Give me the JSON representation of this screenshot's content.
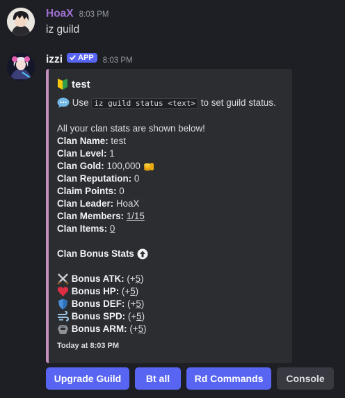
{
  "messages": [
    {
      "username": "HoaX",
      "timestamp": "8:03 PM",
      "text": "iz guild"
    },
    {
      "username": "izzi",
      "badge": "APP",
      "timestamp": "8:03 PM"
    }
  ],
  "embed": {
    "accent_color": "#c38fbe",
    "title": "test",
    "title_icon": "beginner-badge-icon",
    "hint": {
      "icon": "speech-balloon-icon",
      "prefix": "Use",
      "code": "iz guild status <text>",
      "suffix": "to set guild status."
    },
    "intro": "All your clan stats are shown below!",
    "stats": [
      {
        "label": "Clan Name:",
        "value": "test"
      },
      {
        "label": "Clan Level:",
        "value": "1"
      },
      {
        "label": "Clan Gold:",
        "value": "100,000",
        "icon": "gold-coins-icon"
      },
      {
        "label": "Clan Reputation:",
        "value": "0"
      },
      {
        "label": "Claim Points:",
        "value": "0"
      },
      {
        "label": "Clan Leader:",
        "value": "HoaX"
      },
      {
        "label": "Clan Members:",
        "value": "1/15"
      },
      {
        "label": "Clan Items:",
        "value": "0"
      }
    ],
    "bonus_header": "Clan Bonus Stats",
    "bonuses": [
      {
        "label": "Bonus ATK:",
        "prefix": "(+",
        "value": "5",
        "suffix": ")",
        "icon": "crossed-swords-icon"
      },
      {
        "label": "Bonus HP:",
        "prefix": "(+",
        "value": "5",
        "suffix": ")",
        "icon": "heart-icon"
      },
      {
        "label": "Bonus DEF:",
        "prefix": "(+",
        "value": "5",
        "suffix": ")",
        "icon": "shield-icon"
      },
      {
        "label": "Bonus SPD:",
        "prefix": "(+",
        "value": "5",
        "suffix": ")",
        "icon": "wind-icon"
      },
      {
        "label": "Bonus ARM:",
        "prefix": "(+",
        "value": "5",
        "suffix": ")",
        "icon": "armor-icon"
      }
    ],
    "footer": "Today at 8:03 PM"
  },
  "buttons": [
    {
      "label": "Upgrade Guild",
      "style": "primary"
    },
    {
      "label": "Bt all",
      "style": "primary"
    },
    {
      "label": "Rd Commands",
      "style": "primary"
    },
    {
      "label": "Console",
      "style": "secondary"
    }
  ],
  "colors": {
    "background": "#1e1f24",
    "embed_bg": "#2b2d31",
    "blurple": "#5865f2",
    "hoax_name": "#9e6fd1"
  }
}
